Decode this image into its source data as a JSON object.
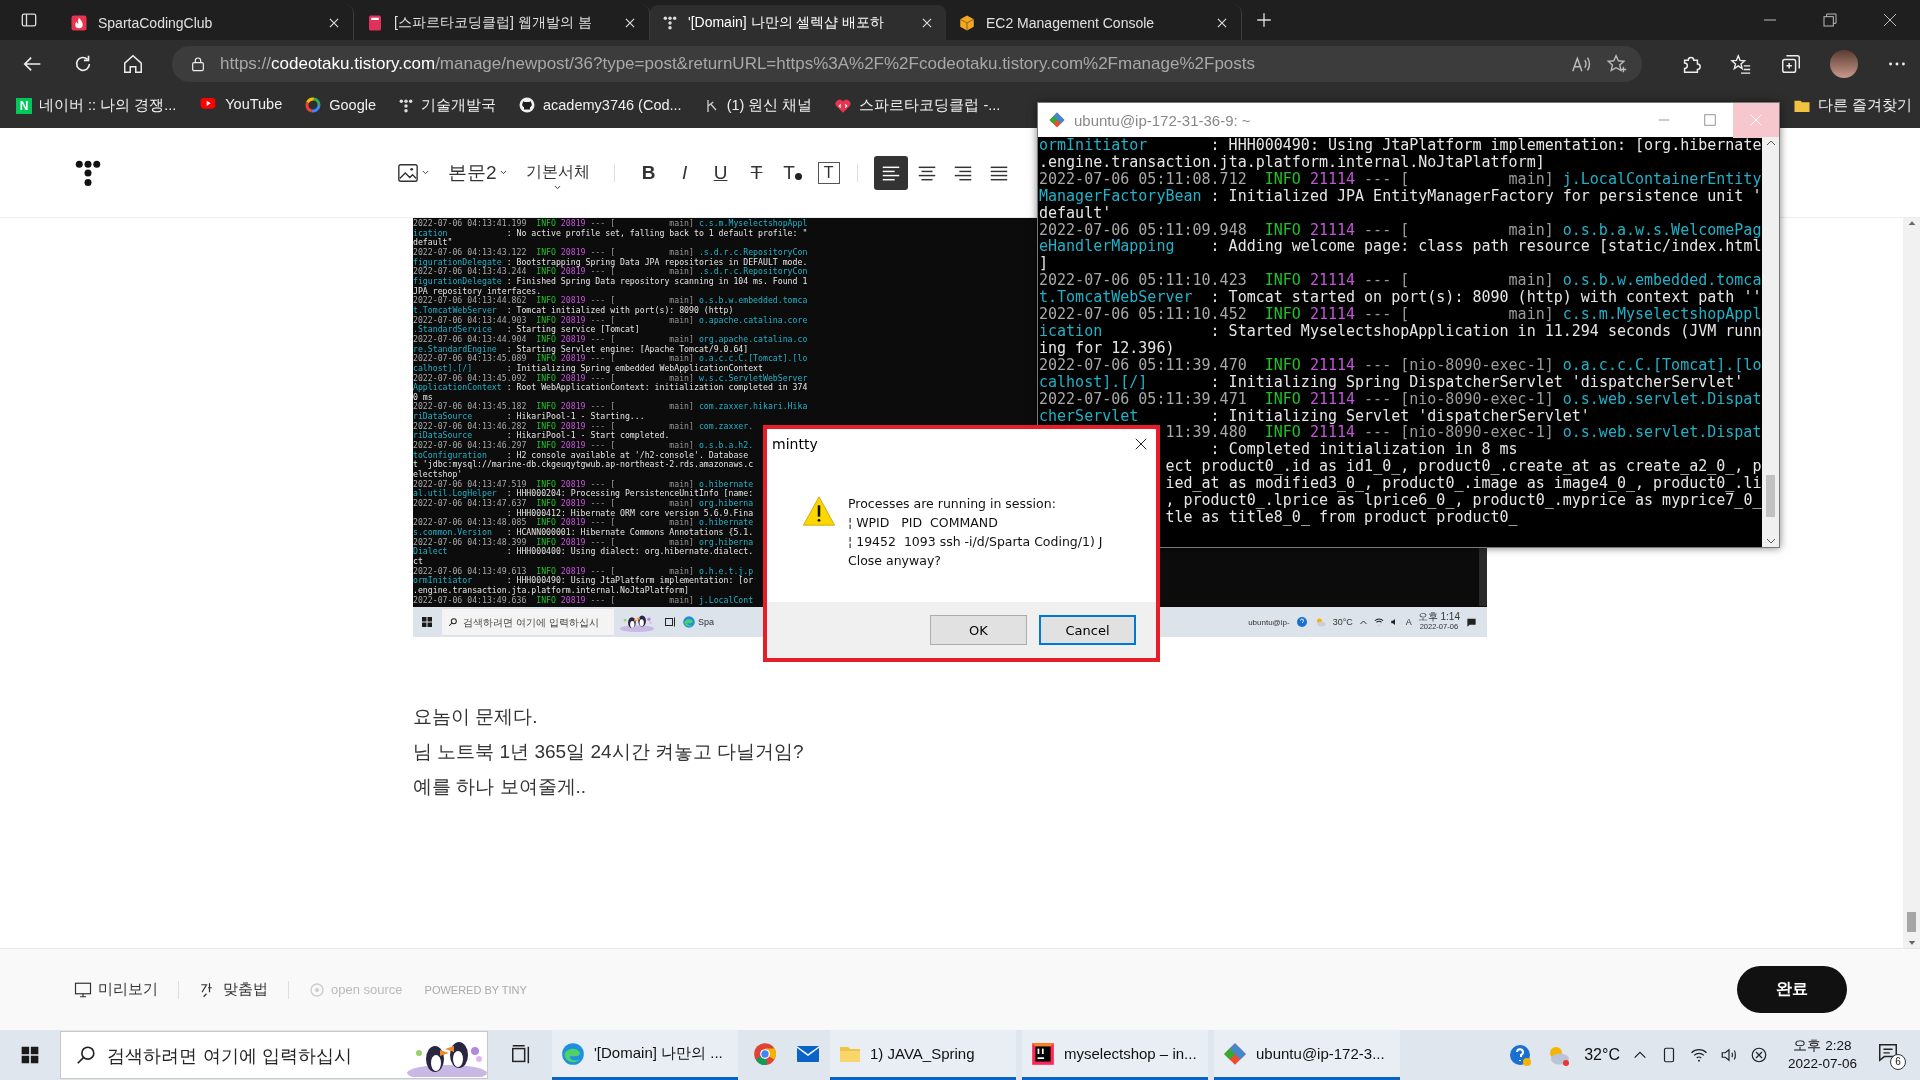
{
  "browser": {
    "tabs": [
      {
        "title": "SpartaCodingClub",
        "kind": "sparta",
        "selected": false
      },
      {
        "title": "[스파르타코딩클럽] 웹개발의 봄",
        "kind": "book",
        "selected": false
      },
      {
        "title": "'[Domain] 나만의 셀렉샵 배포하",
        "kind": "dots",
        "selected": true
      },
      {
        "title": "EC2 Management Console",
        "kind": "cube",
        "selected": false
      }
    ],
    "url": {
      "scheme": "https://",
      "host": "codeotaku.tistory.com",
      "path": "/manage/newpost/36?type=post&returnURL=https%3A%2F%2Fcodeotaku.tistory.com%2Fmanage%2Fposts"
    },
    "bookmarks": [
      {
        "label": "네이버 :: 나의 경쟁...",
        "kind": "naver",
        "icon_letter": "N"
      },
      {
        "label": "YouTube",
        "kind": "youtube"
      },
      {
        "label": "Google",
        "kind": "google"
      },
      {
        "label": "기술개발국",
        "kind": "dots"
      },
      {
        "label": "academy3746 (Cod...",
        "kind": "github"
      },
      {
        "label": "(1) 원신 채널",
        "kind": "genshin"
      },
      {
        "label": "스파르타코딩클럽 -...",
        "kind": "heart"
      }
    ],
    "other_bookmarks": "다른 즐겨찾기"
  },
  "editor": {
    "paragraph_style": "본문2",
    "font": "기본서체",
    "format_buttons": [
      {
        "label": "B",
        "kind": "bold"
      },
      {
        "label": "I",
        "kind": "italic"
      },
      {
        "label": "U",
        "kind": "underline"
      },
      {
        "label": "T",
        "kind": "strike"
      },
      {
        "label": "T",
        "kind": "color"
      },
      {
        "label": "T",
        "kind": "background"
      }
    ],
    "align_buttons": [
      {
        "kind": "left",
        "selected": true
      },
      {
        "kind": "center",
        "selected": false
      },
      {
        "kind": "right",
        "selected": false
      },
      {
        "kind": "justify",
        "selected": false
      }
    ]
  },
  "post": {
    "embedded_screenshot": {
      "log_lines": [
        {
          "kind": "header",
          "time": "2022-07-06 04:13:41.199",
          "level": "INFO",
          "pid": "20819",
          "thread": "--- [           main]",
          "logger": "c.s.m.MyselectshopAppl"
        },
        {
          "kind": "body",
          "logger": "ication",
          "message": ": No active profile set, falling back to 1 default profile: \""
        },
        {
          "kind": "plain",
          "text": "default\""
        },
        {
          "kind": "header",
          "time": "2022-07-06 04:13:43.122",
          "level": "INFO",
          "pid": "20819",
          "thread": "--- [           main]",
          "logger": ".s.d.r.c.RepositoryCon"
        },
        {
          "kind": "body",
          "logger": "figurationDelegate",
          "message": ": Bootstrapping Spring Data JPA repositories in DEFAULT mode."
        },
        {
          "kind": "header",
          "time": "2022-07-06 04:13:43.244",
          "level": "INFO",
          "pid": "20819",
          "thread": "--- [           main]",
          "logger": ".s.d.r.c.RepositoryCon"
        },
        {
          "kind": "body",
          "logger": "figurationDelegate",
          "message": ": Finished Spring Data repository scanning in 104 ms. Found 1"
        },
        {
          "kind": "plain",
          "text": "JPA repository interfaces."
        },
        {
          "kind": "header",
          "time": "2022-07-06 04:13:44.862",
          "level": "INFO",
          "pid": "20819",
          "thread": "--- [           main]",
          "logger": "o.s.b.w.embedded.tomca"
        },
        {
          "kind": "body",
          "logger": "t.TomcatWebServer",
          "message": ": Tomcat initialized with port(s): 8090 (http)"
        },
        {
          "kind": "header",
          "time": "2022-07-06 04:13:44.903",
          "level": "INFO",
          "pid": "20819",
          "thread": "--- [           main]",
          "logger": "o.apache.catalina.core"
        },
        {
          "kind": "body",
          "logger": ".StandardService",
          "message": ": Starting service [Tomcat]"
        },
        {
          "kind": "header",
          "time": "2022-07-06 04:13:44.904",
          "level": "INFO",
          "pid": "20819",
          "thread": "--- [           main]",
          "logger": "org.apache.catalina.co"
        },
        {
          "kind": "body",
          "logger": "re.StandardEngine",
          "message": ": Starting Servlet engine: [Apache Tomcat/9.0.64]"
        },
        {
          "kind": "header",
          "time": "2022-07-06 04:13:45.089",
          "level": "INFO",
          "pid": "20819",
          "thread": "--- [           main]",
          "logger": "o.a.c.c.C.[Tomcat].[lo"
        },
        {
          "kind": "body",
          "logger": "calhost].[/]",
          "message": ": Initializing Spring embedded WebApplicationContext"
        },
        {
          "kind": "header",
          "time": "2022-07-06 04:13:45.092",
          "level": "INFO",
          "pid": "20819",
          "thread": "--- [           main]",
          "logger": "w.s.c.ServletWebServer"
        },
        {
          "kind": "body",
          "logger": "ApplicationContext",
          "message": ": Root WebApplicationContext: initialization completed in 374"
        },
        {
          "kind": "plain",
          "text": "0 ms"
        },
        {
          "kind": "header",
          "time": "2022-07-06 04:13:45.182",
          "level": "INFO",
          "pid": "20819",
          "thread": "--- [           main]",
          "logger": "com.zaxxer.hikari.Hika"
        },
        {
          "kind": "body",
          "logger": "riDataSource",
          "message": ": HikariPool-1 - Starting..."
        },
        {
          "kind": "header",
          "time": "2022-07-06 04:13:46.282",
          "level": "INFO",
          "pid": "20819",
          "thread": "--- [           main]",
          "logger": "com.zaxxer."
        },
        {
          "kind": "body",
          "logger": "riDataSource",
          "message": ": HikariPool-1 - Start completed."
        },
        {
          "kind": "header",
          "time": "2022-07-06 04:13:46.297",
          "level": "INFO",
          "pid": "20819",
          "thread": "--- [           main]",
          "logger": "o.s.b.a.h2."
        },
        {
          "kind": "body",
          "logger": "toConfiguration",
          "message": ": H2 console available at '/h2-console'. Database"
        },
        {
          "kind": "plain",
          "text": "t 'jdbc:mysql://marine-db.ckgeuqytgwub.ap-northeast-2.rds.amazonaws.c"
        },
        {
          "kind": "plain",
          "text": "electshop'"
        },
        {
          "kind": "header",
          "time": "2022-07-06 04:13:47.519",
          "level": "INFO",
          "pid": "20819",
          "thread": "--- [           main]",
          "logger": "o.hibernate"
        },
        {
          "kind": "body",
          "logger": "al.util.LogHelper",
          "message": ": HHH000204: Processing PersistenceUnitInfo [name:"
        },
        {
          "kind": "header",
          "time": "2022-07-06 04:13:47.637",
          "level": "INFO",
          "pid": "20819",
          "thread": "--- [           main]",
          "logger": "org.hiberna"
        },
        {
          "kind": "body",
          "message": ": HHH000412: Hibernate ORM core version 5.6.9.Fina"
        },
        {
          "kind": "header",
          "time": "2022-07-06 04:13:48.085",
          "level": "INFO",
          "pid": "20819",
          "thread": "--- [           main]",
          "logger": "o.hibernate"
        },
        {
          "kind": "body",
          "logger": "s.common.Version",
          "message": ": HCANN000001: Hibernate Commons Annotations {5.1."
        },
        {
          "kind": "header",
          "time": "2022-07-06 04:13:48.399",
          "level": "INFO",
          "pid": "20819",
          "thread": "--- [           main]",
          "logger": "org.hiberna"
        },
        {
          "kind": "body",
          "logger": "Dialect",
          "message": ": HHH000400: Using dialect: org.hibernate.dialect."
        },
        {
          "kind": "plain",
          "text": "ct"
        },
        {
          "kind": "header",
          "time": "2022-07-06 04:13:49.613",
          "level": "INFO",
          "pid": "20819",
          "thread": "--- [           main]",
          "logger": "o.h.e.t.j.p"
        },
        {
          "kind": "body",
          "logger": "ormInitiator",
          "message": ": HHH000490: Using JtaPlatform implementation: [or"
        },
        {
          "kind": "plain",
          "text": ".engine.transaction.jta.platform.internal.NoJtaPlatform]"
        },
        {
          "kind": "header",
          "time": "2022-07-06 04:13:49.636",
          "level": "INFO",
          "pid": "20819",
          "thread": "--- [           main]",
          "logger": "j.LocalCont"
        }
      ],
      "taskbar": {
        "search_placeholder": "검색하려면 여기에 입력하십시",
        "app_label": "Spa",
        "tray_app_label": "ubuntu@ip-",
        "weather": "30°C",
        "ime": "A",
        "time": "오후 1:14",
        "date": "2022-07-06"
      }
    },
    "paragraphs": [
      "요놈이 문제다.",
      "님 노트북 1년 365일 24시간 켜놓고 다닐거임?",
      "예를 하나 보여줄게.."
    ]
  },
  "terminal_window": {
    "title": "ubuntu@ip-172-31-36-9: ~",
    "lines": [
      {
        "kind": "body",
        "logger": "ormInitiator",
        "message": ": HHH000490: Using JtaPlatform implementation: [org.hibernate"
      },
      {
        "kind": "plain",
        "text": ".engine.transaction.jta.platform.internal.NoJtaPlatform]"
      },
      {
        "kind": "header",
        "time": "2022-07-06 05:11:08.712",
        "level": "INFO",
        "pid": "21114",
        "thread": "--- [           main]",
        "logger": "j.LocalContainerEntity"
      },
      {
        "kind": "body",
        "logger": "ManagerFactoryBean",
        "message": ": Initialized JPA EntityManagerFactory for persistence unit '"
      },
      {
        "kind": "plain",
        "text": "default'"
      },
      {
        "kind": "header",
        "time": "2022-07-06 05:11:09.948",
        "level": "INFO",
        "pid": "21114",
        "thread": "--- [           main]",
        "logger": "o.s.b.a.w.s.WelcomePag"
      },
      {
        "kind": "body",
        "logger": "eHandlerMapping",
        "message": ": Adding welcome page: class path resource [static/index.html"
      },
      {
        "kind": "plain",
        "text": "]"
      },
      {
        "kind": "header",
        "time": "2022-07-06 05:11:10.423",
        "level": "INFO",
        "pid": "21114",
        "thread": "--- [           main]",
        "logger": "o.s.b.w.embedded.tomca"
      },
      {
        "kind": "body",
        "logger": "t.TomcatWebServer",
        "message": ": Tomcat started on port(s): 8090 (http) with context path ''"
      },
      {
        "kind": "header",
        "time": "2022-07-06 05:11:10.452",
        "level": "INFO",
        "pid": "21114",
        "thread": "--- [           main]",
        "logger": "c.s.m.MyselectshopAppl"
      },
      {
        "kind": "body",
        "logger": "ication",
        "message": ": Started MyselectshopApplication in 11.294 seconds (JVM runn"
      },
      {
        "kind": "plain",
        "text": "ing for 12.396)"
      },
      {
        "kind": "header",
        "time": "2022-07-06 05:11:39.470",
        "level": "INFO",
        "pid": "21114",
        "thread": "--- [nio-8090-exec-1]",
        "logger": "o.a.c.c.C.[Tomcat].[lo"
      },
      {
        "kind": "body",
        "logger": "calhost].[/]",
        "message": ": Initializing Spring DispatcherServlet 'dispatcherServlet'"
      },
      {
        "kind": "header",
        "time": "2022-07-06 05:11:39.471",
        "level": "INFO",
        "pid": "21114",
        "thread": "--- [nio-8090-exec-1]",
        "logger": "o.s.web.servlet.Dispat"
      },
      {
        "kind": "body",
        "logger": "cherServlet",
        "message": ": Initializing Servlet 'dispatcherServlet'"
      },
      {
        "kind": "header",
        "time": "11:39.480",
        "level": "INFO",
        "pid": "21114",
        "thread": "--- [nio-8090-exec-1]",
        "logger": "o.s.web.servlet.Dispat"
      },
      {
        "kind": "body",
        "message": ": Completed initialization in 8 ms"
      },
      {
        "kind": "tail",
        "text": "ect product0_.id as id1_0_, product0_.create_at as create_a2_0_, p"
      },
      {
        "kind": "tail",
        "text": "ied_at as modified3_0_, product0_.image as image4_0_, product0_.li"
      },
      {
        "kind": "tail",
        "text": ", product0_.lprice as lprice6_0_, product0_.myprice as myprice7_0_"
      },
      {
        "kind": "tail",
        "text": "tle as title8_0_ from product product0_"
      }
    ]
  },
  "dialog": {
    "title": "mintty",
    "message_lines": [
      "Processes are running in session:",
      "¦ WPID   PID  COMMAND",
      "¦ 19452  1093 ssh -i/d/Sparta Coding/1) J",
      "Close anyway?"
    ],
    "buttons": [
      {
        "label": "OK",
        "focused": false
      },
      {
        "label": "Cancel",
        "focused": true
      }
    ]
  },
  "bottom_bar": {
    "preview": "미리보기",
    "spellcheck": "맞춤법",
    "open_source": "open source",
    "powered_by": "POWERED BY TINY",
    "done": "완료"
  },
  "taskbar": {
    "search_placeholder": "검색하려면 여기에 입력하십시",
    "apps": [
      {
        "kind": "edge",
        "label": "'[Domain] 나만의 ...",
        "running": true
      },
      {
        "kind": "chrome",
        "running": false
      },
      {
        "kind": "mail",
        "running": false
      },
      {
        "kind": "folder",
        "label": "1) JAVA_Spring",
        "running": true
      },
      {
        "kind": "intellij",
        "label": "myselectshop – in...",
        "running": true
      },
      {
        "kind": "git",
        "label": "ubuntu@ip-172-3...",
        "running": true
      }
    ],
    "weather": "32°C",
    "time": "오후 2:28",
    "date": "2022-07-06",
    "notifications": "6"
  }
}
